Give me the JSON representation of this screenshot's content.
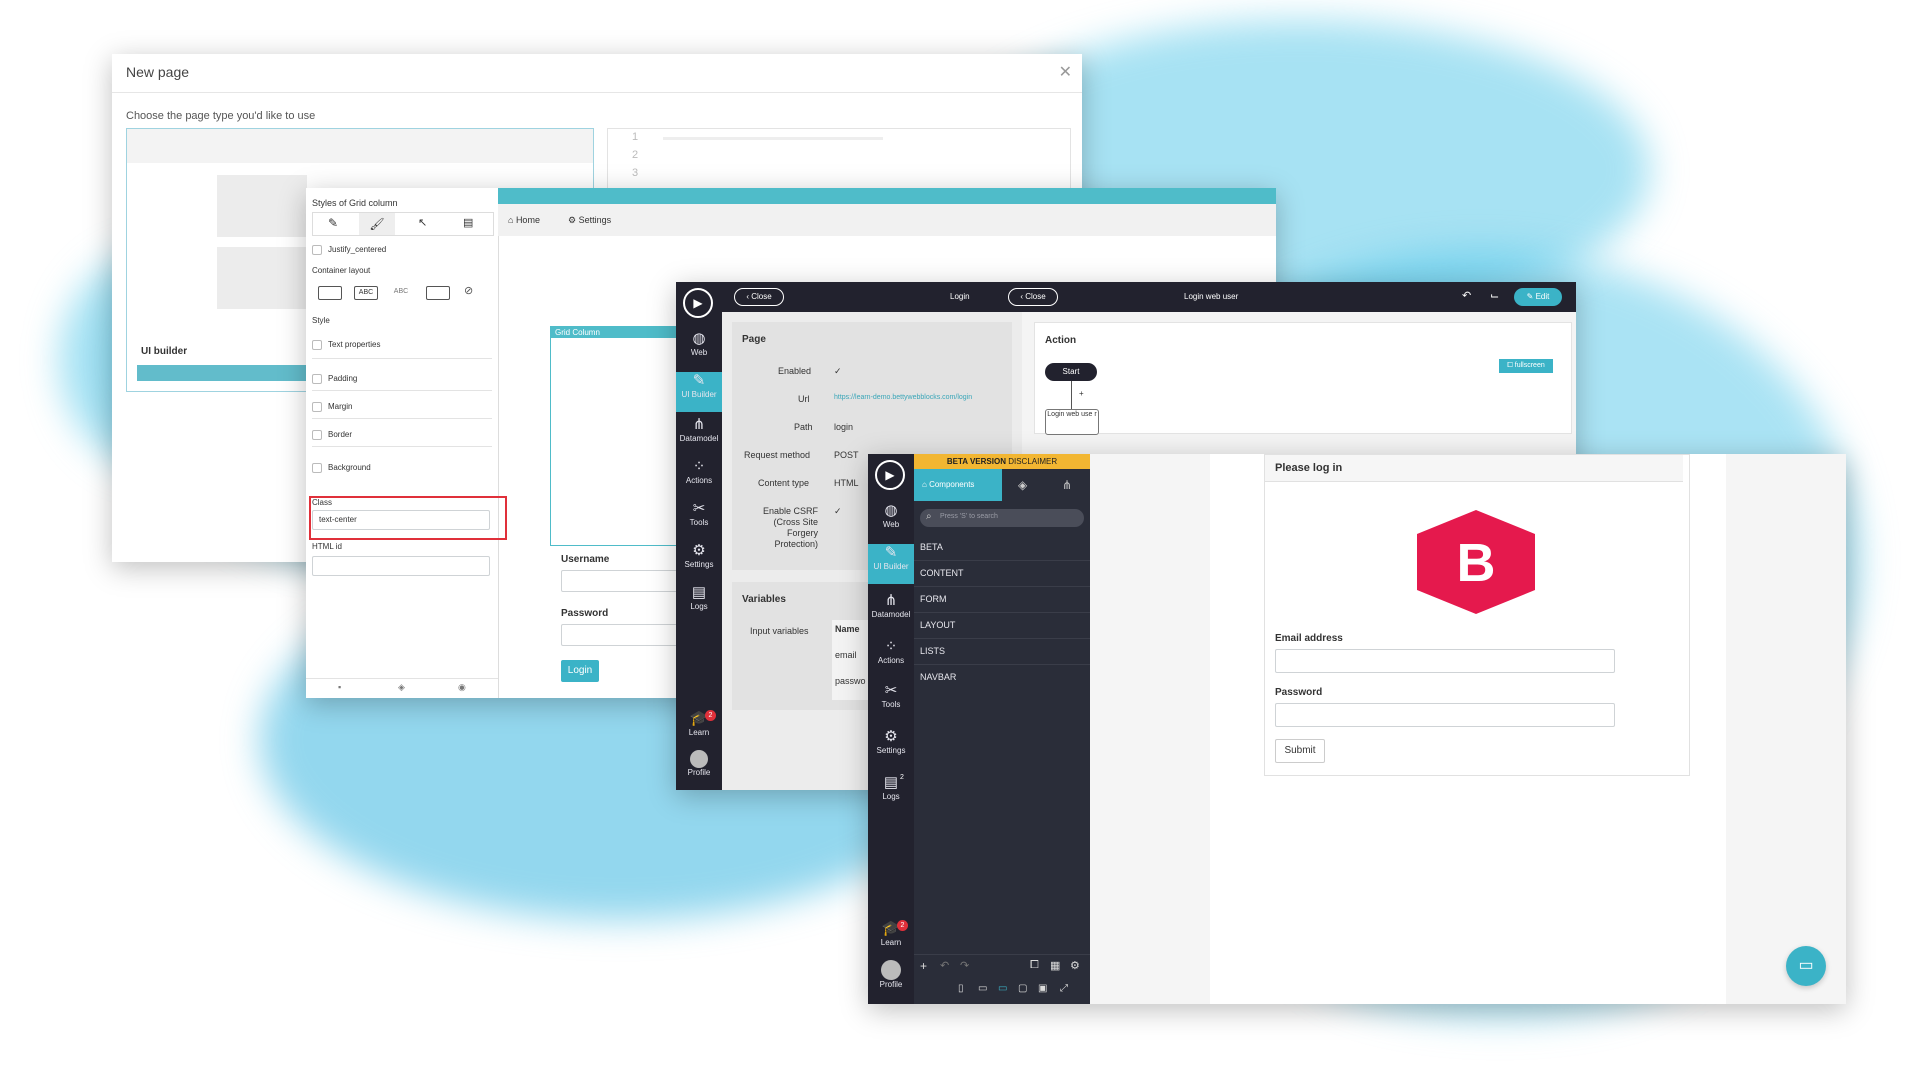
{
  "colors": {
    "accent": "#3bb3c7",
    "dark_rail": "#22222e",
    "brand_red": "#e5194d",
    "highlight_red": "#e0303a"
  },
  "new_page_dialog": {
    "title": "New page",
    "subtitle": "Choose the page type you'd like to use",
    "card_label": "UI builder",
    "line_numbers": [
      "1",
      "2",
      "3"
    ],
    "close_icon": "close-icon"
  },
  "grid_styles_panel": {
    "header": "Styles of Grid column",
    "justify_label": "Justify_centered",
    "container_layout_label": "Container layout",
    "layout_options": [
      "",
      "ABC",
      "ABC",
      "",
      ""
    ],
    "style_label": "Style",
    "options": [
      "Text properties",
      "Padding",
      "Margin",
      "Border",
      "Background"
    ],
    "class_label": "Class",
    "class_value": "text-center",
    "html_id_label": "HTML id"
  },
  "builder_canvas": {
    "nav_home": "Home",
    "nav_settings": "Settings",
    "grid_column_label": "Grid Column",
    "username_label": "Username",
    "password_label": "Password",
    "login_button": "Login"
  },
  "rail_items": [
    {
      "label": "Web",
      "icon": "globe-icon"
    },
    {
      "label": "UI Builder",
      "icon": "brush-icon"
    },
    {
      "label": "Datamodel",
      "icon": "datamodel-icon"
    },
    {
      "label": "Actions",
      "icon": "actions-icon"
    },
    {
      "label": "Tools",
      "icon": "tools-icon"
    },
    {
      "label": "Settings",
      "icon": "gear-icon"
    },
    {
      "label": "Logs",
      "icon": "logs-icon"
    }
  ],
  "rail_bottom": {
    "learn": "Learn",
    "profile": "Profile",
    "learn_badge": "2",
    "logs_badge": "2"
  },
  "action_window": {
    "close_left": "Close",
    "login_title": "Login",
    "close_right": "Close",
    "login_web_user": "Login web user",
    "edit_button": "Edit",
    "page_section": "Page",
    "page_fields": [
      {
        "label": "Enabled",
        "value": "✓"
      },
      {
        "label": "Url",
        "value": "https://learn-demo.bettywebblocks.com/login"
      },
      {
        "label": "Path",
        "value": "login"
      },
      {
        "label": "Request method",
        "value": "POST"
      },
      {
        "label": "Content type",
        "value": "HTML"
      },
      {
        "label": "Enable CSRF (Cross Site Forgery Protection)",
        "value": "✓"
      }
    ],
    "variables_section": "Variables",
    "input_variables_label": "Input variables",
    "variables_column": "Name",
    "variables_rows": [
      "email",
      "passwo"
    ],
    "action_section": "Action",
    "fullscreen_label": "fullscreen",
    "flow_start": "Start",
    "flow_step": "Login web use r",
    "flow_plus": "+"
  },
  "builder_window": {
    "beta_banner_bold": "BETA VERSION",
    "beta_banner_rest": "DISCLAIMER",
    "components_tab": "Components",
    "search_placeholder": "Press 'S' to search",
    "categories": [
      "BETA",
      "CONTENT",
      "FORM",
      "LAYOUT",
      "LISTS",
      "NAVBAR"
    ],
    "preview": {
      "header": "Please log in",
      "logo_letter": "B",
      "email_label": "Email address",
      "password_label": "Password",
      "submit_button": "Submit"
    }
  }
}
